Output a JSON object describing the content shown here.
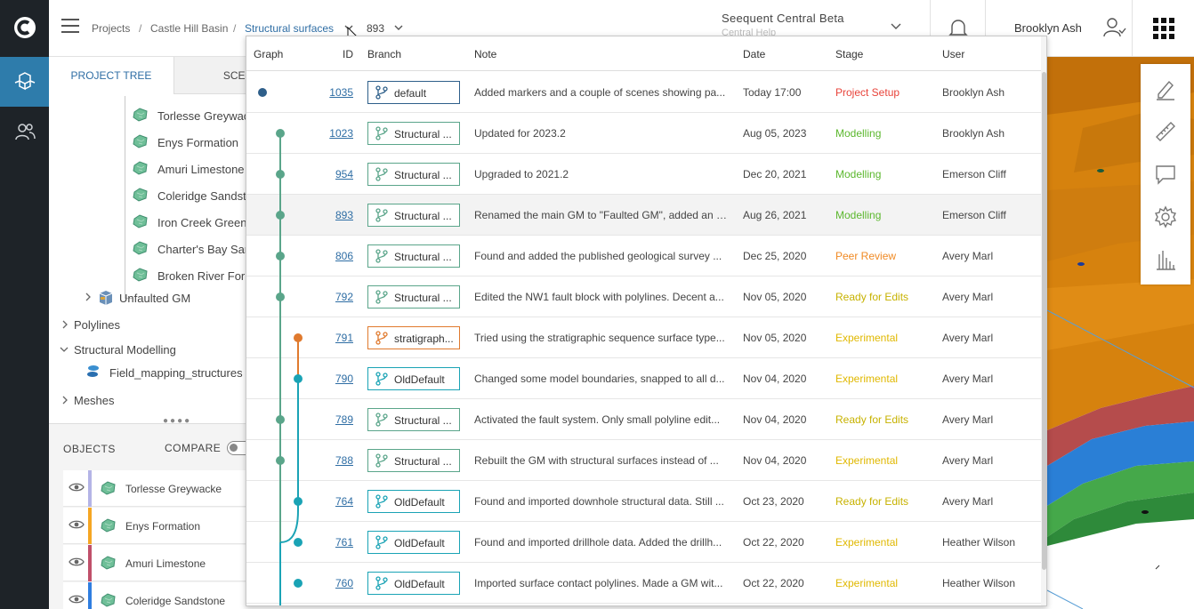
{
  "header": {
    "breadcrumb": [
      "Projects",
      "Castle Hill Basin",
      "Structural surfaces"
    ],
    "separators": [
      "/",
      "/"
    ],
    "version": "893",
    "central_title": "Seequent Central Beta",
    "central_help": "Central Help",
    "user": "Brooklyn Ash"
  },
  "tabs": [
    "PROJECT TREE",
    "SCENES"
  ],
  "tree": {
    "surfaces": [
      "Torlesse Greywacke",
      "Enys Formation",
      "Amuri Limestone",
      "Coleridge Sandstone",
      "Iron Creek Greensand",
      "Charter's Bay Sandstone",
      "Broken River Formation"
    ],
    "unfaulted": "Unfaulted GM",
    "polylines": "Polylines",
    "structural_modelling": "Structural Modelling",
    "field_mapping": "Field_mapping_structures",
    "meshes": "Meshes"
  },
  "objects": {
    "title": "OBJECTS",
    "compare": "COMPARE",
    "items": [
      {
        "label": "Torlesse Greywacke",
        "color": "#b4b4e6"
      },
      {
        "label": "Enys Formation",
        "color": "#f5a623"
      },
      {
        "label": "Amuri Limestone",
        "color": "#c0506a"
      },
      {
        "label": "Coleridge Sandstone",
        "color": "#2f7ee0"
      }
    ]
  },
  "history": {
    "columns": [
      "Graph",
      "ID",
      "Branch",
      "Note",
      "Date",
      "Stage",
      "User"
    ],
    "rows": [
      {
        "id": "1035",
        "branch": "default",
        "note": "Added markers and a couple of scenes showing pa...",
        "date": "Today 17:00",
        "stage": "Project Setup",
        "user": "Brooklyn Ash"
      },
      {
        "id": "1023",
        "branch": "Structural ...",
        "note": "Updated for 2023.2",
        "date": "Aug 05, 2023",
        "stage": "Modelling",
        "user": "Brooklyn Ash"
      },
      {
        "id": "954",
        "branch": "Structural ...",
        "note": "Upgraded to 2021.2",
        "date": "Dec 20, 2021",
        "stage": "Modelling",
        "user": "Emerson Cliff"
      },
      {
        "id": "893",
        "branch": "Structural ...",
        "note": "Renamed the main GM to \"Faulted GM\", added an u...",
        "date": "Aug 26, 2021",
        "stage": "Modelling",
        "user": "Emerson Cliff"
      },
      {
        "id": "806",
        "branch": "Structural ...",
        "note": "Found and added the published geological survey ...",
        "date": "Dec 25, 2020",
        "stage": "Peer Review",
        "user": "Avery Marl"
      },
      {
        "id": "792",
        "branch": "Structural ...",
        "note": "Edited the NW1 fault block with polylines. Decent a...",
        "date": "Nov 05, 2020",
        "stage": "Ready for Edits",
        "user": "Avery Marl"
      },
      {
        "id": "791",
        "branch": "stratigraph...",
        "note": "Tried using the stratigraphic sequence surface type...",
        "date": "Nov 05, 2020",
        "stage": "Experimental",
        "user": "Avery Marl"
      },
      {
        "id": "790",
        "branch": "OldDefault",
        "note": "Changed some model boundaries, snapped to all d...",
        "date": "Nov 04, 2020",
        "stage": "Experimental",
        "user": "Avery Marl"
      },
      {
        "id": "789",
        "branch": "Structural ...",
        "note": "Activated the fault system. Only small polyline edit...",
        "date": "Nov 04, 2020",
        "stage": "Ready for Edits",
        "user": "Avery Marl"
      },
      {
        "id": "788",
        "branch": "Structural ...",
        "note": "Rebuilt the GM with structural surfaces instead of ...",
        "date": "Nov 04, 2020",
        "stage": "Experimental",
        "user": "Avery Marl"
      },
      {
        "id": "764",
        "branch": "OldDefault",
        "note": "Found and imported downhole structural data. Still ...",
        "date": "Oct 23, 2020",
        "stage": "Ready for Edits",
        "user": "Avery Marl"
      },
      {
        "id": "761",
        "branch": "OldDefault",
        "note": "Found and imported drillhole data. Added the drillh...",
        "date": "Oct 22, 2020",
        "stage": "Experimental",
        "user": "Heather Wilson"
      },
      {
        "id": "760",
        "branch": "OldDefault",
        "note": "Imported surface contact polylines. Made a GM wit...",
        "date": "Oct 22, 2020",
        "stage": "Experimental",
        "user": "Heather Wilson"
      }
    ]
  },
  "colors": {
    "accent": "#2e7cab",
    "stage_setup": "#e8433a",
    "stage_modelling": "#5cb82e",
    "stage_review": "#f08a24",
    "stage_ready": "#c7b200",
    "stage_experimental": "#e0b800",
    "branch_structural": "#5aa58a",
    "branch_default": "#2e5f8a",
    "branch_strat": "#e07a2e",
    "branch_old": "#1aa3b5"
  }
}
